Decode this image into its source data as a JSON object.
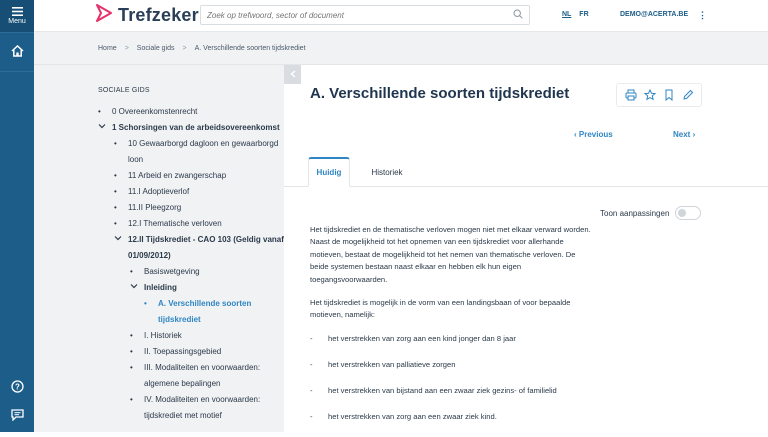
{
  "rail": {
    "menu_label": "Menu"
  },
  "header": {
    "brand": "Trefzeker",
    "search_placeholder": "Zoek op trefwoord, sector of document",
    "lang_nl": "NL",
    "lang_fr": "FR",
    "user": "DEMO@ACERTA.BE",
    "colors": {
      "brand_primary": "#1d5d8a",
      "logo_accent": "#e6316a",
      "link": "#2f86c4"
    }
  },
  "breadcrumb": [
    "Home",
    "Sociale gids",
    "A. Verschillende soorten tijdskrediet"
  ],
  "sidebar": {
    "title": "SOCIALE GIDS",
    "items": [
      {
        "label": "0 Overeenkomstenrecht"
      },
      {
        "label": "1 Schorsingen van de arbeidsovereenkomst"
      },
      {
        "label": "10 Gewaarborgd dagloon en gewaarborgd loon"
      },
      {
        "label": "11 Arbeid en zwangerschap"
      },
      {
        "label": "11.I Adoptieverlof"
      },
      {
        "label": "11.II Pleegzorg"
      },
      {
        "label": "12.I Thematische verloven"
      },
      {
        "label": "12.II Tijdskrediet - CAO 103 (Geldig vanaf 01/09/2012)"
      },
      {
        "label": "Basiswetgeving"
      },
      {
        "label": "Inleiding"
      },
      {
        "label": "A. Verschillende soorten tijdskrediet"
      },
      {
        "label": "I. Historiek"
      },
      {
        "label": "II. Toepassingsgebied"
      },
      {
        "label": "III. Modaliteiten en voorwaarden: algemene bepalingen"
      },
      {
        "label": "IV. Modaliteiten en voorwaarden: tijdskrediet met motief"
      }
    ]
  },
  "article": {
    "title": "A. Verschillende soorten tijdskrediet",
    "prev": "Previous",
    "next": "Next",
    "tabs": [
      "Huidig",
      "Historiek"
    ],
    "toggle_label": "Toon aanpassingen",
    "paragraphs": [
      "Het tijdskrediet en de thematische verloven mogen niet met elkaar verward worden. Naast de mogelijkheid tot het opnemen van een tijdskrediet voor allerhande motieven, bestaat de mogelijkheid tot het nemen van thematische verloven. De beide systemen bestaan naast elkaar en hebben elk hun eigen toegangsvoorwaarden.",
      "Het tijdskrediet is mogelijk in de vorm van een landingsbaan of voor bepaalde motieven, namelijk:"
    ],
    "dashes": [
      "het verstrekken van zorg aan een kind jonger dan 8 jaar",
      "het verstrekken van palliatieve zorgen",
      "het verstrekken van bijstand aan een zwaar ziek gezins- of familielid",
      "het verstrekken van zorg aan een zwaar ziek kind."
    ]
  }
}
